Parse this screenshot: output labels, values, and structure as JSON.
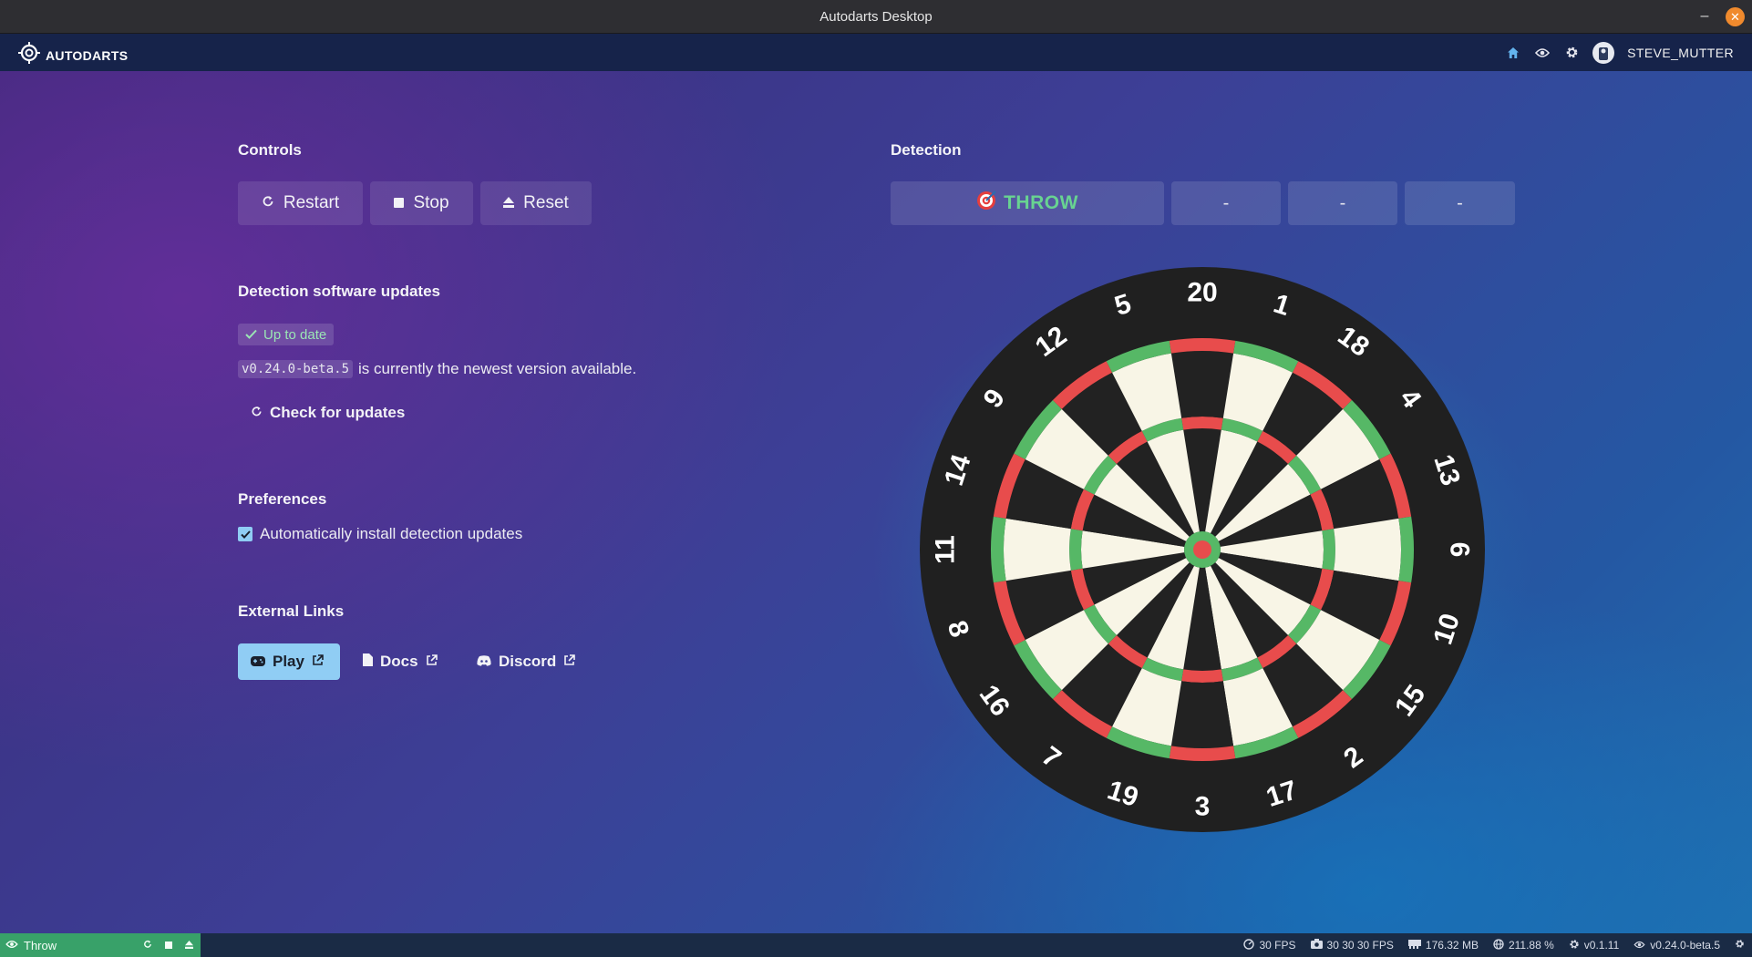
{
  "window": {
    "title": "Autodarts Desktop",
    "minimize": "–",
    "close": "✕"
  },
  "appbar": {
    "brand": "AUTODARTS",
    "username": "STEVE_MUTTER"
  },
  "controls": {
    "title": "Controls",
    "restart": "Restart",
    "stop": "Stop",
    "reset": "Reset"
  },
  "detection": {
    "title": "Detection",
    "status": "THROW",
    "slot1": "-",
    "slot2": "-",
    "slot3": "-"
  },
  "updates": {
    "title": "Detection software updates",
    "badge": "Up to date",
    "version": "v0.24.0-beta.5",
    "version_text": "is currently the newest version available.",
    "check": "Check for updates"
  },
  "preferences": {
    "title": "Preferences",
    "auto_install": "Automatically install detection updates",
    "auto_install_checked": true
  },
  "links": {
    "title": "External Links",
    "play": "Play",
    "docs": "Docs",
    "discord": "Discord"
  },
  "board": {
    "numbers": [
      "20",
      "1",
      "18",
      "4",
      "13",
      "6",
      "10",
      "15",
      "2",
      "17",
      "3",
      "19",
      "7",
      "16",
      "8",
      "11",
      "14",
      "9",
      "12",
      "5"
    ]
  },
  "statusbar": {
    "mode": "Throw",
    "fps": "30 FPS",
    "cam_fps": "30 30 30 FPS",
    "memory": "176.32 MB",
    "cpu": "211.88 %",
    "app_version": "v0.1.11",
    "detection_version": "v0.24.0-beta.5"
  },
  "colors": {
    "accent": "#90cdf4",
    "success": "#68d391",
    "status_green": "#38a169",
    "board_red": "#e84c4c",
    "board_green": "#56b866",
    "board_cream": "#f8f5e6",
    "board_black": "#222222"
  }
}
